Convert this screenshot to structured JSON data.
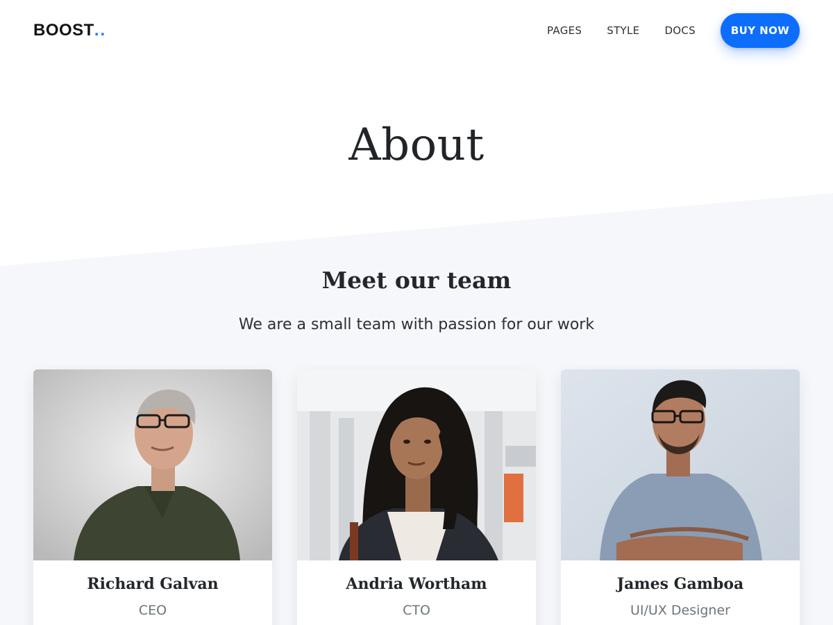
{
  "header": {
    "brand": "BOOST",
    "brand_dots": "..",
    "nav": [
      "PAGES",
      "STYLE",
      "DOCS"
    ],
    "cta_label": "BUY NOW"
  },
  "hero": {
    "title": "About"
  },
  "team": {
    "title": "Meet our team",
    "subtitle": "We are a small team with passion for our work",
    "members": [
      {
        "name": "Richard Galvan",
        "role": "CEO"
      },
      {
        "name": "Andria Wortham",
        "role": "CTO"
      },
      {
        "name": "James Gamboa",
        "role": "UI/UX Designer"
      }
    ]
  },
  "colors": {
    "accent": "#0d6efd",
    "section_background": "#f6f7fa"
  }
}
